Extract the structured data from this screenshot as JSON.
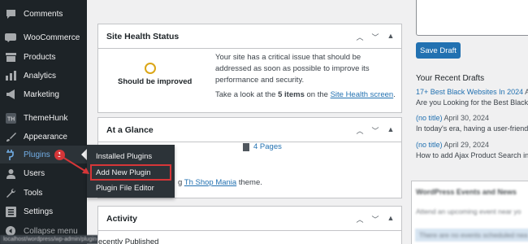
{
  "sidebar": {
    "items": [
      {
        "label": "Comments",
        "icon": "comment-icon"
      },
      {
        "label": "WooCommerce",
        "icon": "woo-icon"
      },
      {
        "label": "Products",
        "icon": "products-icon"
      },
      {
        "label": "Analytics",
        "icon": "analytics-icon"
      },
      {
        "label": "Marketing",
        "icon": "megaphone-icon"
      },
      {
        "label": "ThemeHunk",
        "icon": "themehunk-icon"
      },
      {
        "label": "Appearance",
        "icon": "brush-icon"
      },
      {
        "label": "Plugins",
        "icon": "plug-icon",
        "badge": "1"
      },
      {
        "label": "Users",
        "icon": "user-icon"
      },
      {
        "label": "Tools",
        "icon": "wrench-icon"
      },
      {
        "label": "Settings",
        "icon": "settings-icon"
      },
      {
        "label": "Collapse menu",
        "icon": "collapse-icon"
      }
    ]
  },
  "flyout": {
    "items": [
      "Installed Plugins",
      "Add New Plugin",
      "Plugin File Editor"
    ]
  },
  "site_health": {
    "title": "Site Health Status",
    "status": "Should be improved",
    "message": "Your site has a critical issue that should be addressed as soon as possible to improve its performance and security.",
    "look_prefix": "Take a look at the ",
    "look_count": "5 items",
    "look_mid": " on the ",
    "look_link": "Site Health screen",
    "look_suffix": "."
  },
  "glance": {
    "title": "At a Glance",
    "pages": "4 Pages",
    "theme_prefix": "g ",
    "theme_link": "Th Shop Mania",
    "theme_suffix": " theme."
  },
  "activity": {
    "title": "Activity",
    "recent": "ecently Published"
  },
  "quick_draft": {
    "save_label": "Save Draft",
    "recent_title": "Your Recent Drafts",
    "drafts": [
      {
        "title": "17+ Best Black Websites In 2024",
        "date": " Ap",
        "excerpt": "Are you Looking for the Best Black “"
      },
      {
        "title": "(no title)",
        "date": " April 30, 2024",
        "excerpt": "In today's era, having a user-friendl"
      },
      {
        "title": "(no title)",
        "date": " April 29, 2024",
        "excerpt": "How to add Ajax Product Search in"
      }
    ]
  },
  "events": {
    "title": "WordPress Events and News",
    "line1": "Attend an upcoming event near yo",
    "notice": "There are no events scheduled nea"
  },
  "status_url": "localhost/wordpress/wp-admin/plugin-install.php",
  "colors": {
    "accent": "#2271b1",
    "sidebar": "#1d2327",
    "highlight": "#d63638",
    "warning": "#dba617"
  }
}
